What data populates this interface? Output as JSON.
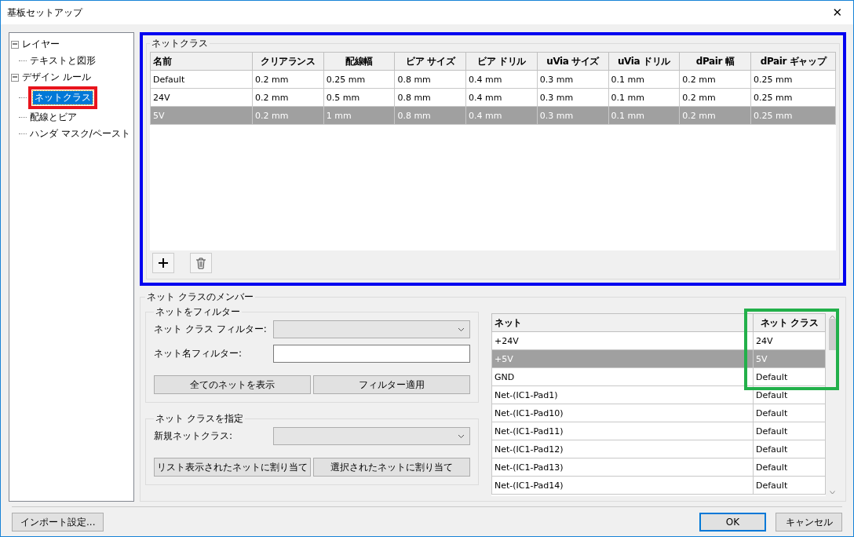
{
  "window": {
    "title": "基板セットアップ",
    "close": "✕"
  },
  "tree": [
    {
      "label": "レイヤー",
      "expanded": true,
      "selected": false,
      "children": [
        {
          "label": "テキストと図形",
          "selected": false
        }
      ]
    },
    {
      "label": "デザイン ルール",
      "expanded": true,
      "selected": false,
      "children": [
        {
          "label": "ネットクラス",
          "selected": true
        },
        {
          "label": "配線とビア",
          "selected": false
        },
        {
          "label": "ハンダ マスク/ペースト",
          "selected": false
        }
      ]
    }
  ],
  "netclasses": {
    "title": "ネットクラス",
    "columns": [
      "名前",
      "クリアランス",
      "配線幅",
      "ビア サイズ",
      "ビア ドリル",
      "uVia サイズ",
      "uVia ドリル",
      "dPair 幅",
      "dPair ギャップ"
    ],
    "rows": [
      {
        "selected": false,
        "cells": [
          "Default",
          "0.2 mm",
          "0.25 mm",
          "0.8 mm",
          "0.4 mm",
          "0.3 mm",
          "0.1 mm",
          "0.2 mm",
          "0.25 mm"
        ]
      },
      {
        "selected": false,
        "cells": [
          "24V",
          "0.2 mm",
          "0.5 mm",
          "0.8 mm",
          "0.4 mm",
          "0.3 mm",
          "0.1 mm",
          "0.2 mm",
          "0.25 mm"
        ]
      },
      {
        "selected": true,
        "cells": [
          "5V",
          "0.2 mm",
          "1 mm",
          "0.8 mm",
          "0.4 mm",
          "0.3 mm",
          "0.1 mm",
          "0.2 mm",
          "0.25 mm"
        ]
      }
    ]
  },
  "members": {
    "title": "ネット クラスのメンバー",
    "filter": {
      "title": "ネットをフィルター",
      "class_label": "ネット クラス フィルター:",
      "name_label": "ネット名フィルター:",
      "buttons": [
        "全てのネットを表示",
        "フィルター適用"
      ]
    },
    "assign": {
      "title": "ネット クラスを指定",
      "class_label": "新規ネットクラス:",
      "buttons": [
        "リスト表示されたネットに割り当て",
        "選択されたネットに割り当て"
      ]
    },
    "nets": {
      "columns": [
        "ネット",
        "ネット クラス"
      ],
      "rows": [
        {
          "selected": false,
          "cells": [
            "+24V",
            "24V"
          ]
        },
        {
          "selected": true,
          "cells": [
            "+5V",
            "5V"
          ]
        },
        {
          "selected": false,
          "cells": [
            "GND",
            "Default"
          ]
        },
        {
          "selected": false,
          "cells": [
            "Net-(IC1-Pad1)",
            "Default"
          ]
        },
        {
          "selected": false,
          "cells": [
            "Net-(IC1-Pad10)",
            "Default"
          ]
        },
        {
          "selected": false,
          "cells": [
            "Net-(IC1-Pad11)",
            "Default"
          ]
        },
        {
          "selected": false,
          "cells": [
            "Net-(IC1-Pad12)",
            "Default"
          ]
        },
        {
          "selected": false,
          "cells": [
            "Net-(IC1-Pad13)",
            "Default"
          ]
        },
        {
          "selected": false,
          "cells": [
            "Net-(IC1-Pad14)",
            "Default"
          ]
        }
      ]
    }
  },
  "footer": {
    "import": "インポート設定...",
    "ok": "OK",
    "cancel": "キャンセル"
  }
}
